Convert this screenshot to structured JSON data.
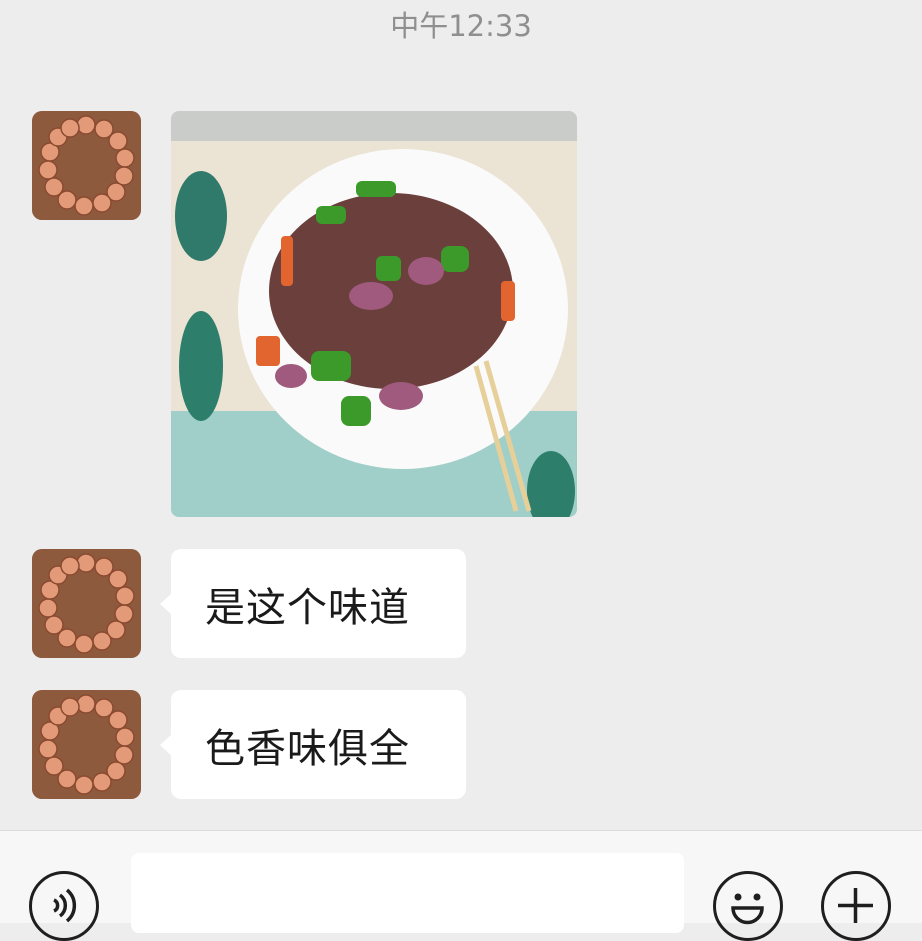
{
  "timestamp": "中午12:33",
  "messages": [
    {
      "type": "image",
      "sender": "contact",
      "content": "stir-fried dish photo"
    },
    {
      "type": "text",
      "sender": "contact",
      "text": "是这个味道"
    },
    {
      "type": "text",
      "sender": "contact",
      "text": "色香味俱全"
    }
  ],
  "input": {
    "value": "",
    "placeholder": ""
  },
  "icons": {
    "voice": "voice-icon",
    "emoji": "emoji-icon",
    "plus": "plus-icon"
  },
  "colors": {
    "background": "#ededed",
    "bubble": "#ffffff",
    "timestamp": "#8f8f8f"
  }
}
